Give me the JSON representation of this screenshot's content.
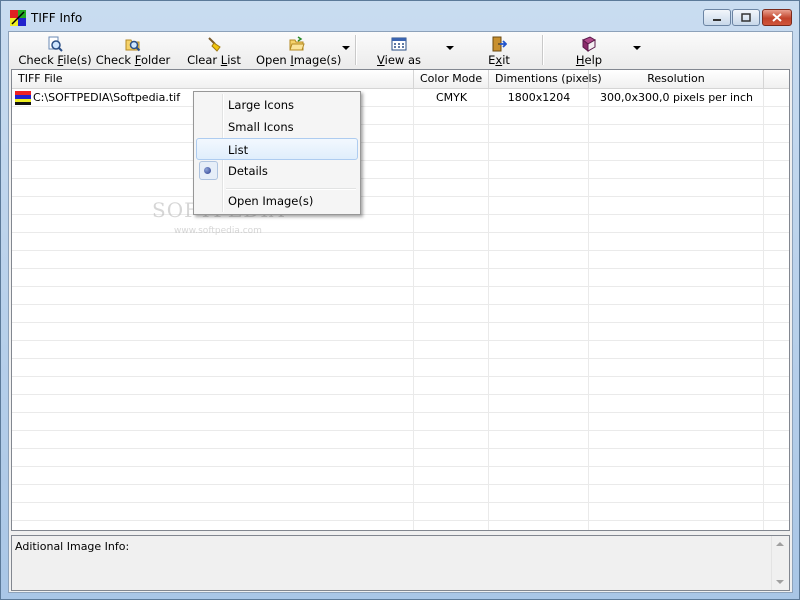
{
  "window": {
    "title": "TIFF Info"
  },
  "toolbar": {
    "check_files": {
      "pre": "Check ",
      "u": "F",
      "post": "ile(s)"
    },
    "check_folder": {
      "pre": "Check ",
      "u": "F",
      "post": "older"
    },
    "clear_list": {
      "pre": "Clear ",
      "u": "L",
      "post": "ist"
    },
    "open_images": {
      "pre": "Open ",
      "u": "I",
      "post": "mage(s)"
    },
    "view_as": {
      "pre": "",
      "u": "V",
      "post": "iew as"
    },
    "exit": {
      "pre": "E",
      "u": "x",
      "post": "it"
    },
    "help": {
      "pre": "",
      "u": "H",
      "post": "elp"
    }
  },
  "table": {
    "columns": [
      "TIFF File",
      "Color Mode",
      "Dimentions (pixels)",
      "Resolution"
    ],
    "rows": [
      {
        "file": "C:\\SOFTPEDIA\\Softpedia.tif",
        "color_mode": "CMYK",
        "dimensions": "1800x1204",
        "resolution": "300,0x300,0 pixels per inch"
      }
    ]
  },
  "context_menu": {
    "items": [
      "Large Icons",
      "Small Icons",
      "List",
      "Details",
      "Open Image(s)"
    ],
    "selected": "Details",
    "highlighted": "List"
  },
  "watermark": {
    "main": "SOFTPEDIA",
    "sub": "www.softpedia.com"
  },
  "info_panel": {
    "label": "Aditional Image Info:"
  }
}
